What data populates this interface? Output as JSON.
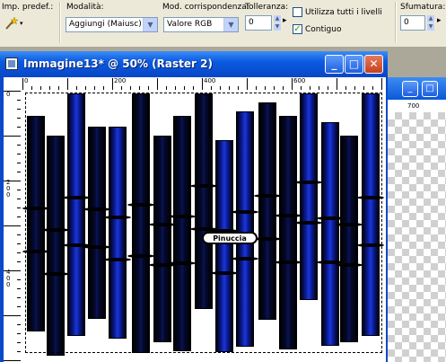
{
  "toolbar": {
    "preset_label": "Imp. predef.:",
    "mode_label": "Modalità:",
    "mode_value": "Aggiungi (Maiusc)",
    "match_label": "Mod. corrispondenza:",
    "match_value": "Valore RGB",
    "tolerance_label": "Tolleranza:",
    "tolerance_value": "0",
    "all_layers_label": "Utilizza tutti i livelli",
    "all_layers_checked": false,
    "contiguous_label": "Contiguo",
    "contiguous_checked": true,
    "feather_label": "Sfumatura:",
    "feather_value": "0"
  },
  "window": {
    "title": "Immagine13* @  50% (Raster 2)",
    "ruler_top_labels": [
      "0",
      "200",
      "400",
      "600"
    ],
    "ruler_left_labels": [
      "0",
      "2\n0\n0",
      "4\n0\n0"
    ]
  },
  "background_window": {
    "ruler_label": "700"
  },
  "canvas": {
    "watermark": "Pinuccia"
  },
  "colors": {
    "title_bar": "#0b5ae0",
    "stripe_blue": "#1a35e0",
    "close_button": "#c6401c"
  }
}
